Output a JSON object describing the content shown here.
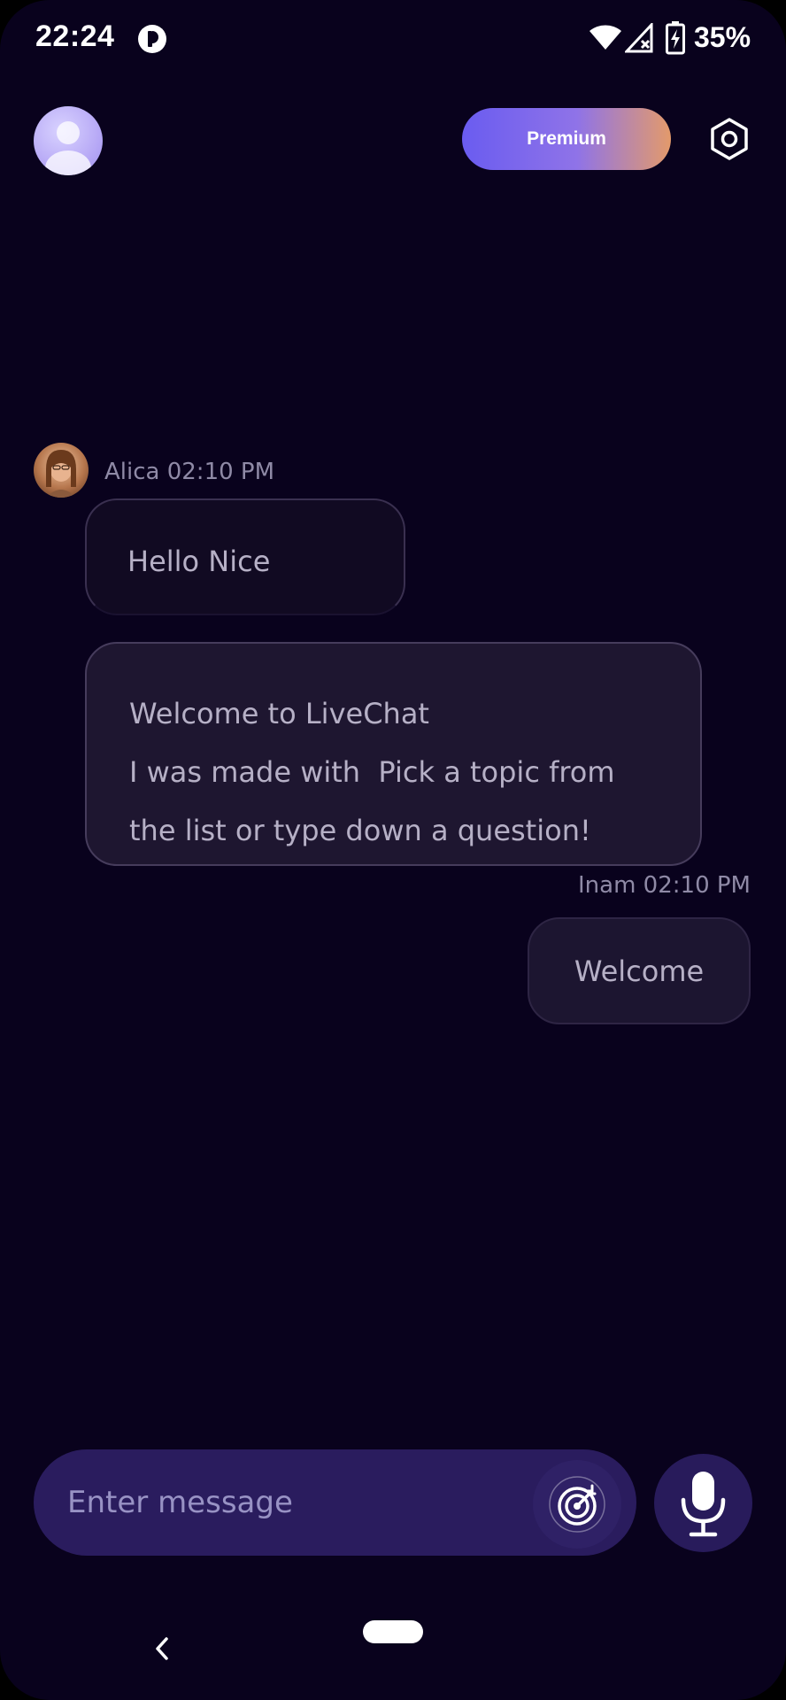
{
  "status_bar": {
    "time": "22:24",
    "battery": "35%",
    "icons": [
      "app-icon",
      "wifi-icon",
      "signal-off-icon",
      "battery-charging-icon"
    ]
  },
  "header": {
    "premium_label": "Premium",
    "avatar_icon": "user-icon",
    "settings_icon": "settings-hexagon-icon"
  },
  "messages": [
    {
      "sender": "Alica 02:10 PM",
      "text": "Hello Nice"
    },
    {
      "lines": [
        "Welcome to LiveChat",
        "I was made with  Pick a topic from",
        "the list or type down a question!"
      ]
    },
    {
      "sender": "Inam 02:10 PM",
      "text": "Welcome"
    }
  ],
  "composer": {
    "placeholder": "Enter message",
    "value": "",
    "topic_icon": "target-icon",
    "mic_icon": "microphone-icon"
  },
  "colors": {
    "background": "#09021d",
    "composer": "#2a1c5e",
    "premium_start": "#6a5cf0",
    "premium_end": "#e39a6b"
  }
}
